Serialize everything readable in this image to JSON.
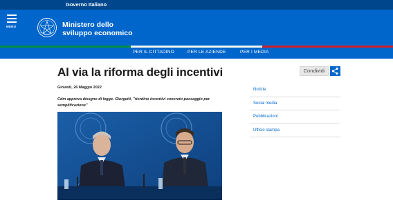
{
  "topbar": {
    "label": "Governo Italiano"
  },
  "header": {
    "menu_label": "MENU",
    "brand_line1": "Ministero dello",
    "brand_line2": "sviluppo economico",
    "emblem_icon": "emblem-icon",
    "colors": {
      "primary": "#0066cc",
      "topbar": "#00468c",
      "green": "#008c45",
      "white": "#f4f5f0",
      "red": "#cd212a"
    }
  },
  "nav": {
    "items": [
      {
        "label": "PER IL CITTADINO"
      },
      {
        "label": "PER LE AZIENDE"
      },
      {
        "label": "PER I MEDIA"
      }
    ]
  },
  "article": {
    "title": "Al via la riforma degli incentivi",
    "date": "Giovedì, 26 Maggio 2022",
    "subtitle": "Cdm approva disegno di legge. Giorgetti, \"riordino incentivi concreto passaggio per semplificazione\"",
    "share_label": "Condividi",
    "share_icon": "share-icon"
  },
  "sidebar": {
    "items": [
      {
        "label": "Notizie"
      },
      {
        "label": "Social media"
      },
      {
        "label": "Pubblicazioni"
      },
      {
        "label": "Ufficio stampa"
      }
    ]
  }
}
